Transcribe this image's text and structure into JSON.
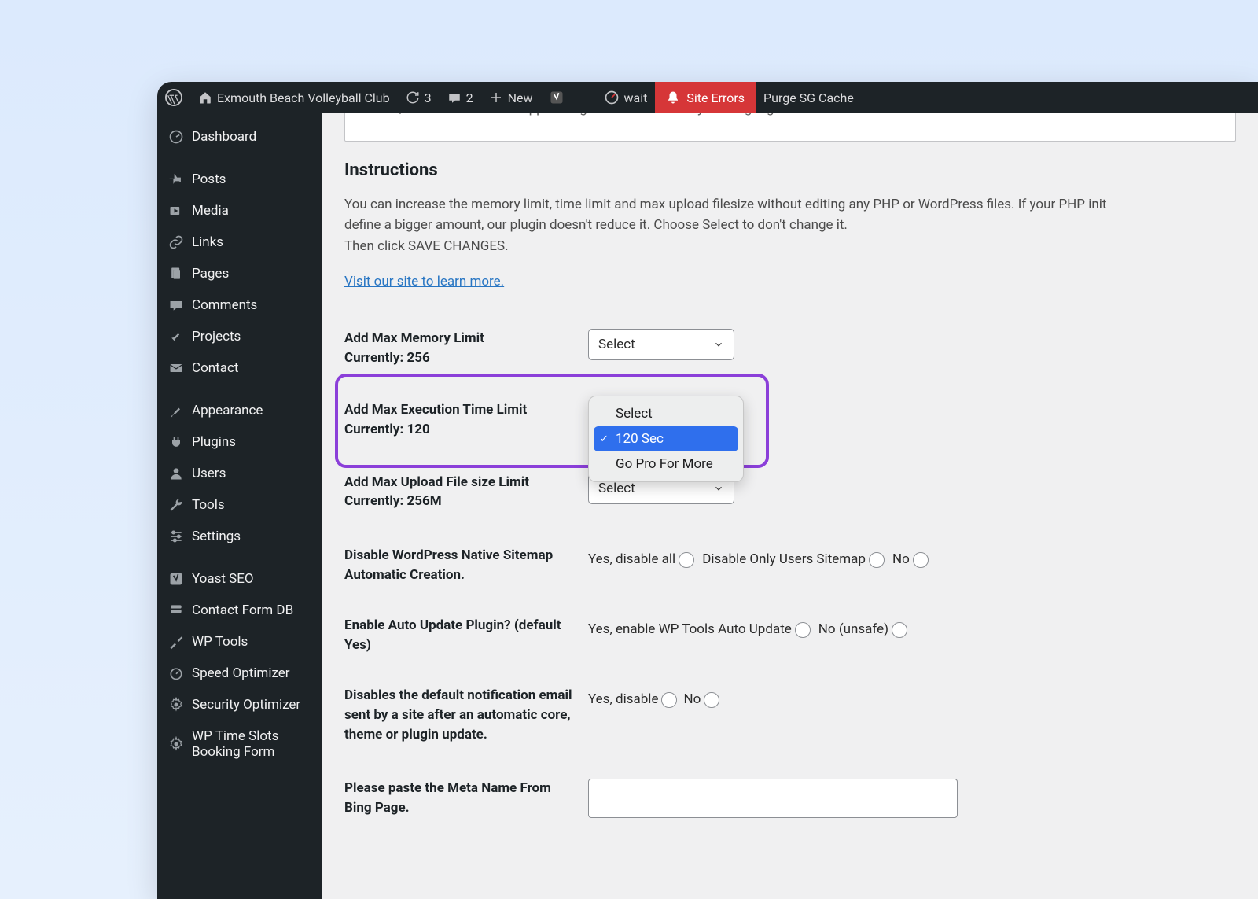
{
  "adminbar": {
    "site_title": "Exmouth Beach Volleyball Club",
    "updates_count": "3",
    "comments_count": "2",
    "new_label": "New",
    "wait_label": "wait",
    "site_errors_label": "Site Errors",
    "purge_label": "Purge SG Cache"
  },
  "sidebar": {
    "items": [
      {
        "label": "Dashboard"
      },
      {
        "label": "Posts"
      },
      {
        "label": "Media"
      },
      {
        "label": "Links"
      },
      {
        "label": "Pages"
      },
      {
        "label": "Comments"
      },
      {
        "label": "Projects"
      },
      {
        "label": "Contact"
      },
      {
        "label": "Appearance"
      },
      {
        "label": "Plugins"
      },
      {
        "label": "Users"
      },
      {
        "label": "Tools"
      },
      {
        "label": "Settings"
      },
      {
        "label": "Yoast SEO"
      },
      {
        "label": "Contact Form DB"
      },
      {
        "label": "WP Tools"
      },
      {
        "label": "Speed Optimizer"
      },
      {
        "label": "Security Optimizer"
      },
      {
        "label": "WP Time Slots Booking Form"
      }
    ]
  },
  "notice_text": "Please, contact me at our Support Page to translate it on your language.",
  "instructions": {
    "heading": "Instructions",
    "body1": "You can increase the memory limit, time limit and max upload filesize without editing any PHP or WordPress files. If your PHP init define a bigger amount, our plugin doesn't reduce it. Choose Select to don't change it.",
    "body2": "Then click SAVE CHANGES.",
    "link": "Visit our site to learn more."
  },
  "settings": {
    "memory": {
      "label": "Add Max Memory Limit",
      "current": "Currently: 256",
      "select": "Select"
    },
    "exec": {
      "label": "Add Max Execution Time Limit",
      "current": "Currently: 120",
      "options": [
        "Select",
        "120 Sec",
        "Go Pro For More"
      ]
    },
    "upload": {
      "label": "Add Max Upload File size Limit",
      "current": "Currently: 256M",
      "select": "Select"
    },
    "sitemap": {
      "label": "Disable WordPress Native Sitemap Automatic Creation.",
      "opt1": "Yes, disable all",
      "opt2": "Disable Only Users Sitemap",
      "opt3": "No"
    },
    "autoupdate": {
      "label": "Enable Auto Update Plugin? (default Yes)",
      "opt1": "Yes, enable WP Tools Auto Update",
      "opt2": "No (unsafe)"
    },
    "email": {
      "label": "Disables the default notification email sent by a site after an automatic core, theme or plugin update.",
      "opt1": "Yes, disable",
      "opt2": "No"
    },
    "metaname": {
      "label": "Please paste the Meta Name From Bing Page."
    }
  }
}
